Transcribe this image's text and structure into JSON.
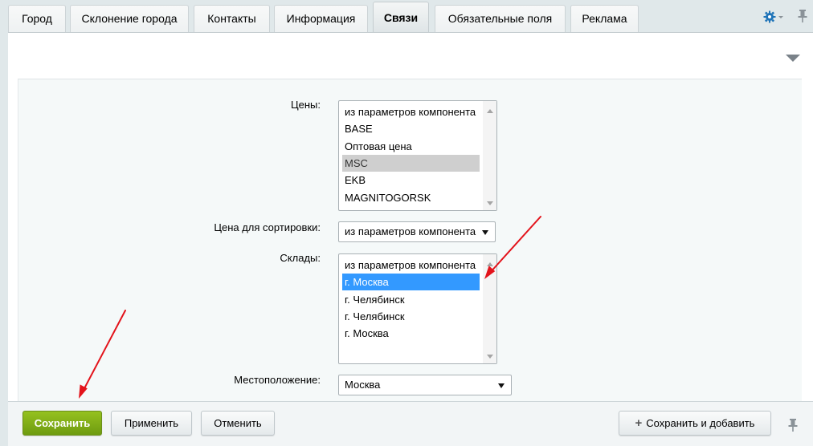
{
  "tabs": [
    {
      "label": "Город",
      "active": false
    },
    {
      "label": "Склонение города",
      "active": false
    },
    {
      "label": "Контакты",
      "active": false
    },
    {
      "label": "Информация",
      "active": false
    },
    {
      "label": "Связи",
      "active": true
    },
    {
      "label": "Обязательные поля",
      "active": false
    },
    {
      "label": "Реклама",
      "active": false
    }
  ],
  "header_icons": {
    "settings": "gear-icon",
    "pin": "pin-icon"
  },
  "form": {
    "prices": {
      "label": "Цены:",
      "options": [
        "из параметров компонента",
        "BASE",
        "Оптовая цена",
        "MSC",
        "EKB",
        "MAGNITOGORSK"
      ],
      "selected": "MSC"
    },
    "sort_price": {
      "label": "Цена для сортировки:",
      "value": "из параметров компонента"
    },
    "warehouses": {
      "label": "Склады:",
      "options": [
        "из параметров компонента",
        "г. Москва",
        "г. Челябинск",
        "г. Челябинск",
        "г. Москва"
      ],
      "selected": "г. Москва"
    },
    "location": {
      "label": "Местоположение:",
      "value": "Москва"
    }
  },
  "buttons": {
    "save": "Сохранить",
    "apply": "Применить",
    "cancel": "Отменить",
    "save_and_add": "Сохранить и добавить"
  },
  "colors": {
    "primary_green": "#7ba91a",
    "selection_blue": "#3399ff",
    "selection_gray": "#cfcfcf",
    "annotation_red": "#e3131b",
    "gear_blue": "#1f74b8"
  }
}
